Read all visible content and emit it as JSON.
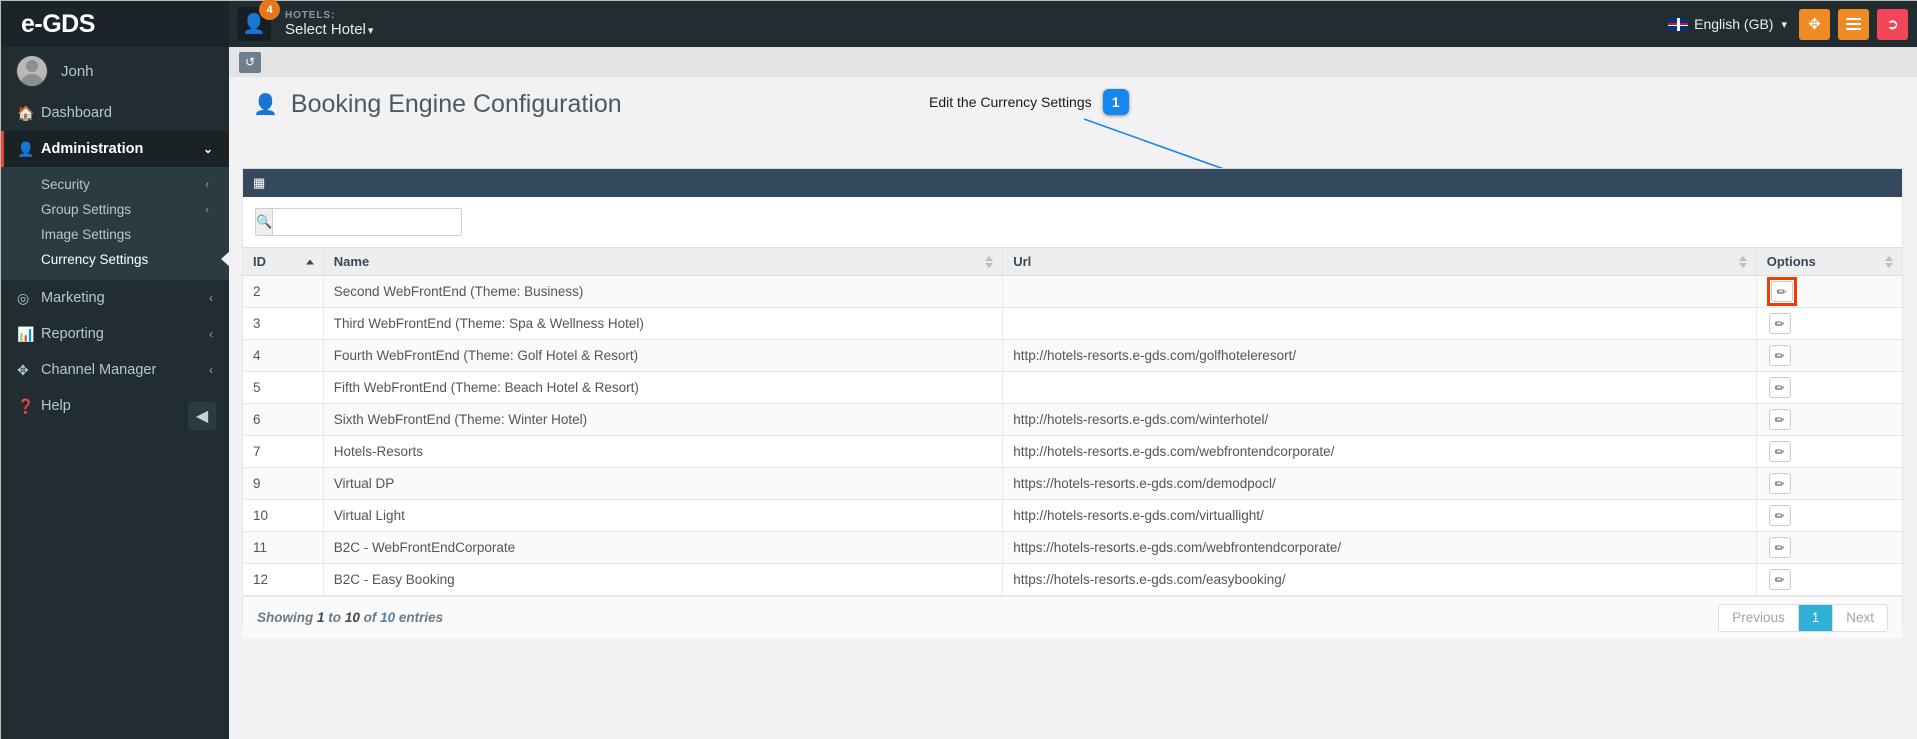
{
  "topbar": {
    "brand": "e-GDS",
    "avatar_badge": "4",
    "hotels_label": "HOTELS:",
    "hotel_selected": "Select Hotel",
    "caret": "⌄",
    "language": "English (GB)",
    "buttons": {
      "fullscreen": "fullscreen-icon",
      "menu": "hamburger-icon",
      "logout": "logout-icon"
    },
    "colors": {
      "orange": "#ef8b24",
      "red": "#f3465b",
      "dark": "#222d32"
    }
  },
  "sidebar": {
    "user": "Jonh",
    "items": [
      {
        "label": "Dashboard",
        "icon": "home-icon",
        "arrow": ""
      },
      {
        "label": "Administration",
        "icon": "user-icon",
        "arrow": "⌄"
      },
      {
        "label": "Marketing",
        "icon": "target-icon",
        "arrow": "‹"
      },
      {
        "label": "Reporting",
        "icon": "bar-chart-icon",
        "arrow": "‹"
      },
      {
        "label": "Channel Manager",
        "icon": "move-icon",
        "arrow": "‹"
      },
      {
        "label": "Help",
        "icon": "question-circle-icon",
        "arrow": "‹"
      }
    ],
    "submenu": [
      {
        "label": "Security",
        "arrow": "‹"
      },
      {
        "label": "Group Settings",
        "arrow": "‹"
      },
      {
        "label": "Image Settings",
        "arrow": ""
      },
      {
        "label": "Currency Settings",
        "arrow": ""
      }
    ],
    "collapse_icon": "arrow-circle-left-icon"
  },
  "page": {
    "refresh_icon": "refresh-icon",
    "title": "Booking Engine Configuration",
    "title_icon": "user-icon",
    "callout_text": "Edit the Currency Settings",
    "callout_badge": "1",
    "callout_color": "#1787f0",
    "highlight_color": "#f03c02"
  },
  "panel": {
    "head_icon": "table-icon",
    "search_value": "",
    "search_placeholder": "",
    "search_icon": "search-icon",
    "columns": [
      {
        "label": "ID",
        "sort": "asc"
      },
      {
        "label": "Name",
        "sort": "none"
      },
      {
        "label": "Url",
        "sort": "none"
      },
      {
        "label": "Options",
        "sort": "none"
      }
    ],
    "rows": [
      {
        "id": "2",
        "name": "Second WebFrontEnd (Theme: Business)",
        "url": "",
        "highlight": true
      },
      {
        "id": "3",
        "name": "Third WebFrontEnd (Theme: Spa & Wellness Hotel)",
        "url": "",
        "highlight": false
      },
      {
        "id": "4",
        "name": "Fourth WebFrontEnd (Theme: Golf Hotel & Resort)",
        "url": "http://hotels-resorts.e-gds.com/golfhoteleresort/",
        "highlight": false
      },
      {
        "id": "5",
        "name": "Fifth WebFrontEnd (Theme: Beach Hotel & Resort)",
        "url": "",
        "highlight": false
      },
      {
        "id": "6",
        "name": "Sixth WebFrontEnd (Theme: Winter Hotel)",
        "url": "http://hotels-resorts.e-gds.com/winterhotel/",
        "highlight": false
      },
      {
        "id": "7",
        "name": "Hotels-Resorts",
        "url": "http://hotels-resorts.e-gds.com/webfrontendcorporate/",
        "highlight": false
      },
      {
        "id": "9",
        "name": "Virtual DP",
        "url": "https://hotels-resorts.e-gds.com/demodpocl/",
        "highlight": false
      },
      {
        "id": "10",
        "name": "Virtual Light",
        "url": "http://hotels-resorts.e-gds.com/virtuallight/",
        "highlight": false
      },
      {
        "id": "11",
        "name": "B2C - WebFrontEndCorporate",
        "url": "https://hotels-resorts.e-gds.com/webfrontendcorporate/",
        "highlight": false
      },
      {
        "id": "12",
        "name": "B2C - Easy Booking",
        "url": "https://hotels-resorts.e-gds.com/easybooking/",
        "highlight": false
      }
    ],
    "edit_icon": "pencil-icon",
    "footer": {
      "showing_prefix": "Showing",
      "from": "1",
      "to_word": "to",
      "to": "10",
      "of_word": "of",
      "total": "10",
      "entries_word": "entries"
    },
    "pagination": {
      "previous": "Previous",
      "pages": [
        "1"
      ],
      "next": "Next",
      "active": "1",
      "active_color": "#31b0d5"
    }
  }
}
